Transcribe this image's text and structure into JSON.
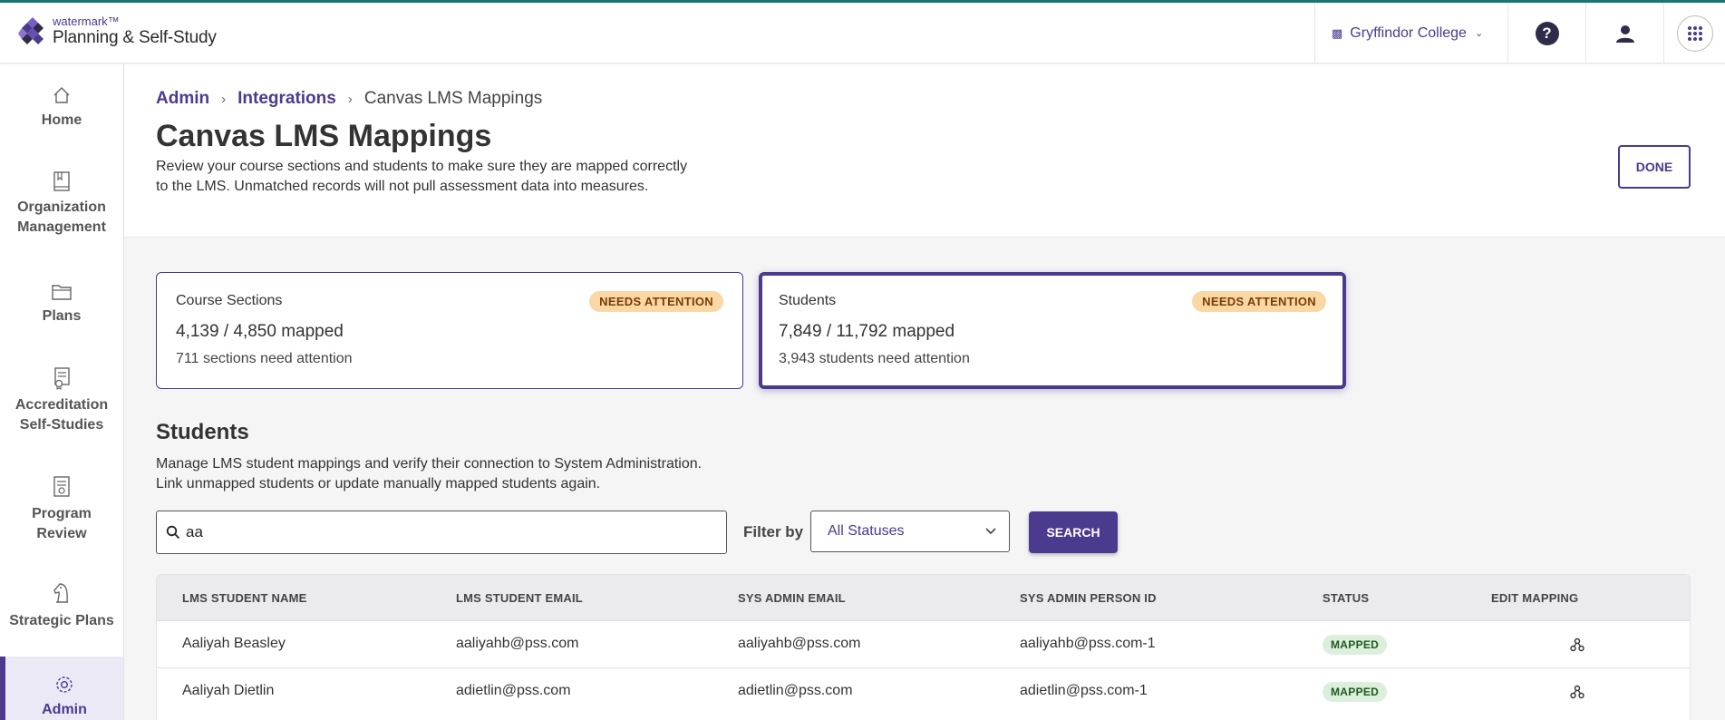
{
  "brand": {
    "small": "watermark™",
    "name": "Planning & Self-Study"
  },
  "topbar": {
    "college": "Gryffindor College",
    "icons": [
      "building-icon",
      "help-icon",
      "user-icon",
      "apps-grid-icon"
    ]
  },
  "sidebar": {
    "items": [
      {
        "label": "Home",
        "icon": "home-icon"
      },
      {
        "label": "Organization Management",
        "icon": "book-icon"
      },
      {
        "label": "Plans",
        "icon": "folder-icon"
      },
      {
        "label": "Accreditation Self-Studies",
        "icon": "certificate-icon"
      },
      {
        "label": "Program Review",
        "icon": "document-review-icon"
      },
      {
        "label": "Strategic Plans",
        "icon": "chess-knight-icon"
      },
      {
        "label": "Admin",
        "icon": "gear-icon",
        "active": true
      }
    ]
  },
  "breadcrumb": {
    "admin": "Admin",
    "integrations": "Integrations",
    "current": "Canvas LMS Mappings"
  },
  "page": {
    "title": "Canvas LMS Mappings",
    "description": "Review your course sections and students to make sure they are mapped correctly to the LMS. Unmatched records will not pull assessment data into measures.",
    "done_label": "DONE"
  },
  "cards": [
    {
      "label": "Course Sections",
      "badge": "NEEDS ATTENTION",
      "value": "4,139 / 4,850 mapped",
      "sub": "711 sections need attention"
    },
    {
      "label": "Students",
      "badge": "NEEDS ATTENTION",
      "value": "7,849 / 11,792 mapped",
      "sub": "3,943 students need attention",
      "selected": true
    }
  ],
  "students_section": {
    "title": "Students",
    "description_line1": "Manage LMS student mappings and verify their connection to System Administration.",
    "description_line2": "Link unmapped students or update manually mapped students again."
  },
  "search": {
    "value": "aa",
    "filter_label": "Filter by",
    "filter_value": "All Statuses",
    "button": "SEARCH"
  },
  "table": {
    "headers": [
      "LMS STUDENT NAME",
      "LMS STUDENT EMAIL",
      "SYS ADMIN EMAIL",
      "SYS ADMIN PERSON ID",
      "STATUS",
      "EDIT MAPPING"
    ],
    "rows": [
      {
        "name": "Aaliyah Beasley",
        "lms_email": "aaliyahb@pss.com",
        "sys_email": "aaliyahb@pss.com",
        "person_id": "aaliyahb@pss.com-1",
        "status": "MAPPED"
      },
      {
        "name": "Aaliyah Dietlin",
        "lms_email": "adietlin@pss.com",
        "sys_email": "adietlin@pss.com",
        "person_id": "adietlin@pss.com-1",
        "status": "MAPPED"
      }
    ]
  },
  "colors": {
    "accent": "#4c3a8e",
    "top_border": "#17776d",
    "badge_warning": "#fbd7a6",
    "badge_success": "#dcefdc"
  }
}
